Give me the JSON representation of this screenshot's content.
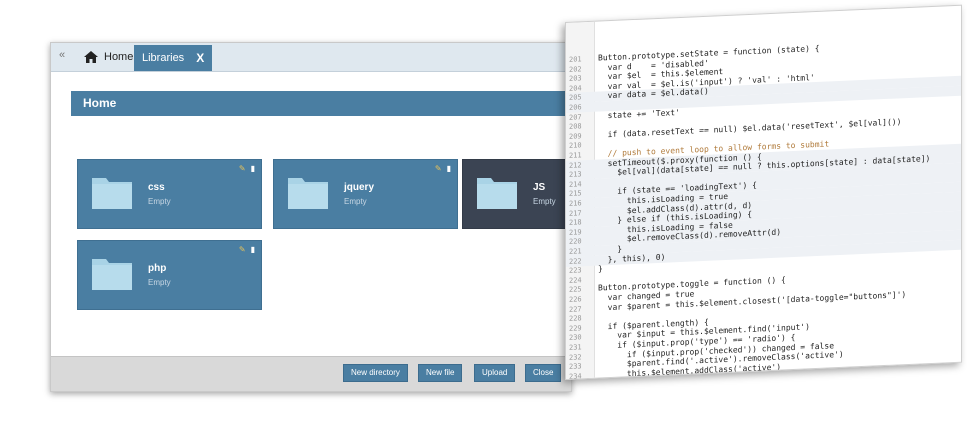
{
  "tabs": {
    "back_label": "«",
    "home_label": "Home",
    "libraries_label": "Libraries",
    "close_label": "X"
  },
  "header": {
    "title": "Home"
  },
  "folders": [
    {
      "name": "css",
      "status": "Empty"
    },
    {
      "name": "jquery",
      "status": "Empty"
    },
    {
      "name": "JS",
      "status": "Empty"
    },
    {
      "name": "php",
      "status": "Empty"
    }
  ],
  "footer": {
    "new_directory": "New directory",
    "new_file": "New file",
    "upload": "Upload",
    "close": "Close"
  },
  "code": {
    "lines": [
      {
        "n": "201",
        "t": "Button.prototype.setState = function (state) {"
      },
      {
        "n": "202",
        "t": "  var d    = 'disabled'"
      },
      {
        "n": "203",
        "t": "  var $el  = this.$element"
      },
      {
        "n": "204",
        "t": "  var val  = $el.is('input') ? 'val' : 'html'"
      },
      {
        "n": "205",
        "t": "  var data = $el.data()"
      },
      {
        "n": "206",
        "t": ""
      },
      {
        "n": "207",
        "t": "  state += 'Text'"
      },
      {
        "n": "208",
        "t": ""
      },
      {
        "n": "209",
        "t": "  if (data.resetText == null) $el.data('resetText', $el[val]())"
      },
      {
        "n": "210",
        "t": ""
      },
      {
        "n": "211",
        "t": "  // push to event loop to allow forms to submit"
      },
      {
        "n": "212",
        "t": "  setTimeout($.proxy(function () {"
      },
      {
        "n": "213",
        "t": "    $el[val](data[state] == null ? this.options[state] : data[state])"
      },
      {
        "n": "214",
        "t": ""
      },
      {
        "n": "215",
        "t": "    if (state == 'loadingText') {"
      },
      {
        "n": "216",
        "t": "      this.isLoading = true"
      },
      {
        "n": "217",
        "t": "      $el.addClass(d).attr(d, d)"
      },
      {
        "n": "218",
        "t": "    } else if (this.isLoading) {"
      },
      {
        "n": "219",
        "t": "      this.isLoading = false"
      },
      {
        "n": "220",
        "t": "      $el.removeClass(d).removeAttr(d)"
      },
      {
        "n": "221",
        "t": "    }"
      },
      {
        "n": "222",
        "t": "  }, this), 0)"
      },
      {
        "n": "223",
        "t": "}"
      },
      {
        "n": "224",
        "t": ""
      },
      {
        "n": "225",
        "t": "Button.prototype.toggle = function () {"
      },
      {
        "n": "226",
        "t": "  var changed = true"
      },
      {
        "n": "227",
        "t": "  var $parent = this.$element.closest('[data-toggle=\"buttons\"]')"
      },
      {
        "n": "228",
        "t": ""
      },
      {
        "n": "229",
        "t": "  if ($parent.length) {"
      },
      {
        "n": "230",
        "t": "    var $input = this.$element.find('input')"
      },
      {
        "n": "231",
        "t": "    if ($input.prop('type') == 'radio') {"
      },
      {
        "n": "232",
        "t": "      if ($input.prop('checked')) changed = false"
      },
      {
        "n": "233",
        "t": "      $parent.find('.active').removeClass('active')"
      },
      {
        "n": "234",
        "t": "      this.$element.addClass('active')"
      }
    ]
  },
  "colors": {
    "accent": "#4a7ea2",
    "folder_dark": "#3b4453",
    "folder_icon": "#a9d3e6"
  }
}
